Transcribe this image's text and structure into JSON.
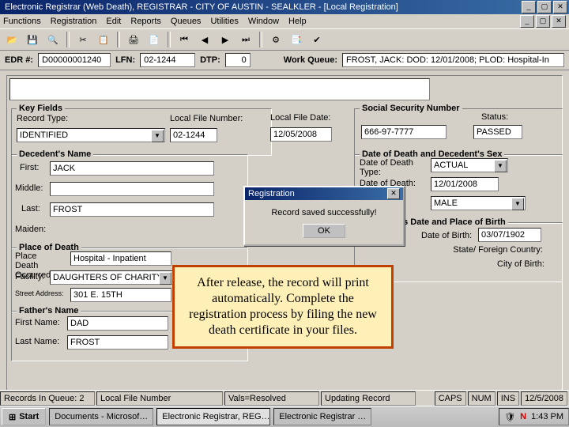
{
  "title": "Electronic Registrar (Web Death), REGISTRAR - CITY OF AUSTIN - SEALKLER - [Local Registration]",
  "menus": {
    "functions": "Functions",
    "registration": "Registration",
    "edit": "Edit",
    "reports": "Reports",
    "queues": "Queues",
    "utilities": "Utilities",
    "window": "Window",
    "help": "Help"
  },
  "idbar": {
    "edr_lbl": "EDR #:",
    "edr": "D00000001240",
    "lfn_lbl": "LFN:",
    "lfn": "02-1244",
    "dtp_lbl": "DTP:",
    "dtp": "0",
    "wq_lbl": "Work Queue:",
    "wq": "FROST, JACK:  DOD: 12/01/2008; PLOD: Hospital-In"
  },
  "key": {
    "legend": "Key Fields",
    "rectype_lbl": "Record Type:",
    "rectype": "IDENTIFIED",
    "localfile_lbl": "Local File Number:",
    "localfile": "02-1244",
    "localdate_lbl": "Local File Date:",
    "localdate": "12/05/2008"
  },
  "ssn": {
    "legend": "Social Security Number",
    "value": "666-97-7777",
    "status_lbl": "Status:",
    "status": "PASSED"
  },
  "name": {
    "legend": "Decedent's Name",
    "first_lbl": "First:",
    "first": "JACK",
    "middle_lbl": "Middle:",
    "middle": "",
    "last_lbl": "Last:",
    "last": "FROST",
    "maiden_lbl": "Maiden:"
  },
  "dod": {
    "legend": "Date of Death and Decedent's Sex",
    "type_lbl": "Date of Death Type:",
    "type": "ACTUAL",
    "date_lbl": "Date of Death:",
    "date": "12/01/2008",
    "sex_lbl": "Sex:",
    "sex": "MALE"
  },
  "dob": {
    "legend": "Decedent's Date and Place of Birth",
    "dob_lbl": "Date of Birth:",
    "dob": "03/07/1902",
    "state_lbl": "State/ Foreign Country:",
    "city_lbl": "City of Birth:"
  },
  "pod": {
    "legend": "Place of Death",
    "occ_lbl": "Place Death Occurred:",
    "occ": "Hospital - Inpatient",
    "fac_lbl": "Facility:",
    "fac": "DAUGHTERS OF CHARITY",
    "addr_lbl": "Street Address:",
    "addr": "301 E. 15TH"
  },
  "father": {
    "legend": "Father's Name",
    "first_lbl": "First Name:",
    "first": "DAD",
    "last_lbl": "Last Name:",
    "last": "FROST"
  },
  "dialog": {
    "title": "Registration",
    "msg": "Record saved successfully!",
    "ok": "OK",
    "close": "✕"
  },
  "annot": "After release, the record will print automatically.  Complete the registration process by filing the new death certificate in your files.",
  "status": {
    "rec": "Records In Queue: 2",
    "lfn": "Local File Number",
    "vals": "Vals=Resolved",
    "upd": "Updating Record",
    "caps": "CAPS",
    "num": "NUM",
    "ins": "INS",
    "date": "12/5/2008"
  },
  "taskbar": {
    "start": "Start",
    "t1": "Documents - Microsof…",
    "t2": "Electronic Registrar, REG…",
    "t3": "Electronic Registrar …",
    "time": "1:43 PM"
  }
}
